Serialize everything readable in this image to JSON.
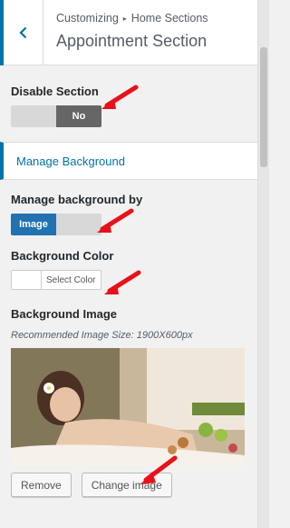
{
  "header": {
    "crumb_root": "Customizing",
    "crumb_sep": "▸",
    "crumb_section": "Home Sections",
    "title": "Appointment Section"
  },
  "disable_section": {
    "label": "Disable Section",
    "value": "No"
  },
  "manage_background": {
    "label": "Manage Background"
  },
  "manage_by": {
    "label": "Manage background by",
    "value": "Image"
  },
  "background_color": {
    "label": "Background Color",
    "button": "Select Color",
    "swatch_color": "#ffffff"
  },
  "background_image": {
    "label": "Background Image",
    "note": "Recommended Image Size: 1900X600px",
    "remove_label": "Remove",
    "change_label": "Change image"
  },
  "colors": {
    "accent": "#0073aa",
    "annotation_arrow": "#e8111a"
  }
}
